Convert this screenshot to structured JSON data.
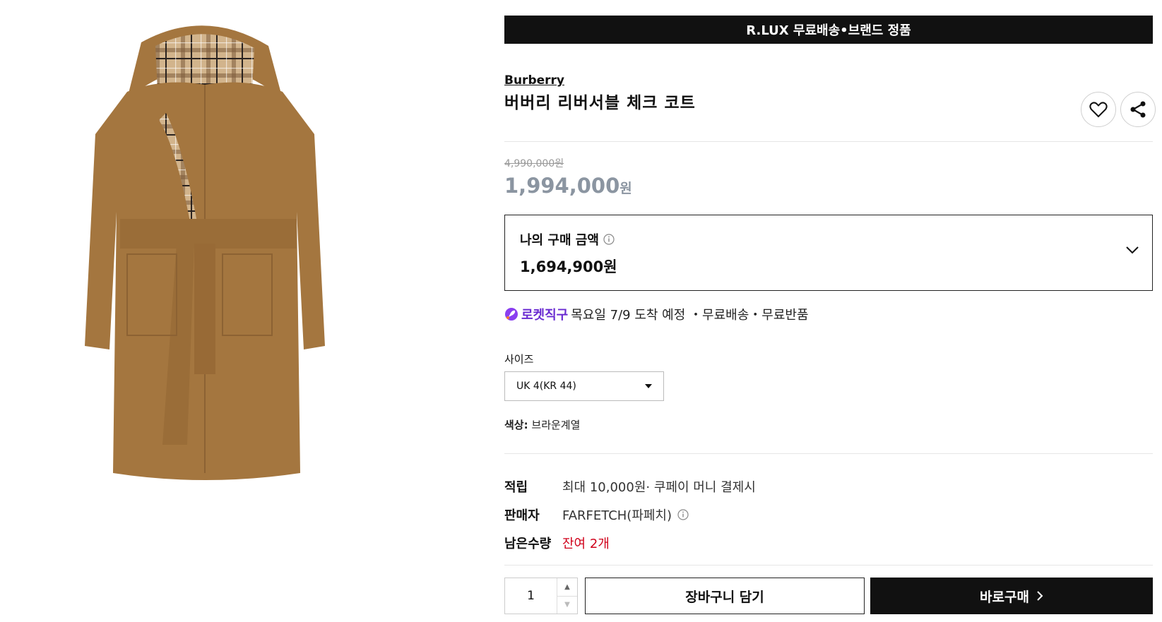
{
  "banner": {
    "text": "R.LUX 무료배송•브랜드 정품"
  },
  "product": {
    "brand": "Burberry",
    "title": "버버리 리버서블 체크 코트",
    "original_price": "4,990,000원",
    "sale_price": "1,994,000",
    "sale_price_unit": "원"
  },
  "actions": {
    "wishlist_icon": "heart-icon",
    "share_icon": "share-icon"
  },
  "my_price": {
    "label": "나의 구매 금액",
    "amount": "1,694,900원"
  },
  "delivery": {
    "badge": "로켓직구",
    "text": "목요일 7/9 도착 예정 ・무료배송・무료반품"
  },
  "size": {
    "label": "사이즈",
    "selected": "UK 4(KR 44)"
  },
  "color": {
    "label": "색상:",
    "value": "브라운계열"
  },
  "info": {
    "points_key": "적립",
    "points_value": "최대 10,000원· 쿠페이 머니 결제시",
    "seller_key": "판매자",
    "seller_value": "FARFETCH(파페치)",
    "stock_key": "남은수량",
    "stock_value": "잔여 2개"
  },
  "purchase": {
    "quantity": "1",
    "cart_label": "장바구니 담기",
    "buy_label": "바로구매"
  },
  "colors": {
    "banner_bg": "#111111",
    "sale_price": "#8b95a1",
    "rocket": "#6a2bd1",
    "stock_red": "#d0021b",
    "coat_camel": "#a4763f",
    "check_beige": "#c9a77c"
  }
}
